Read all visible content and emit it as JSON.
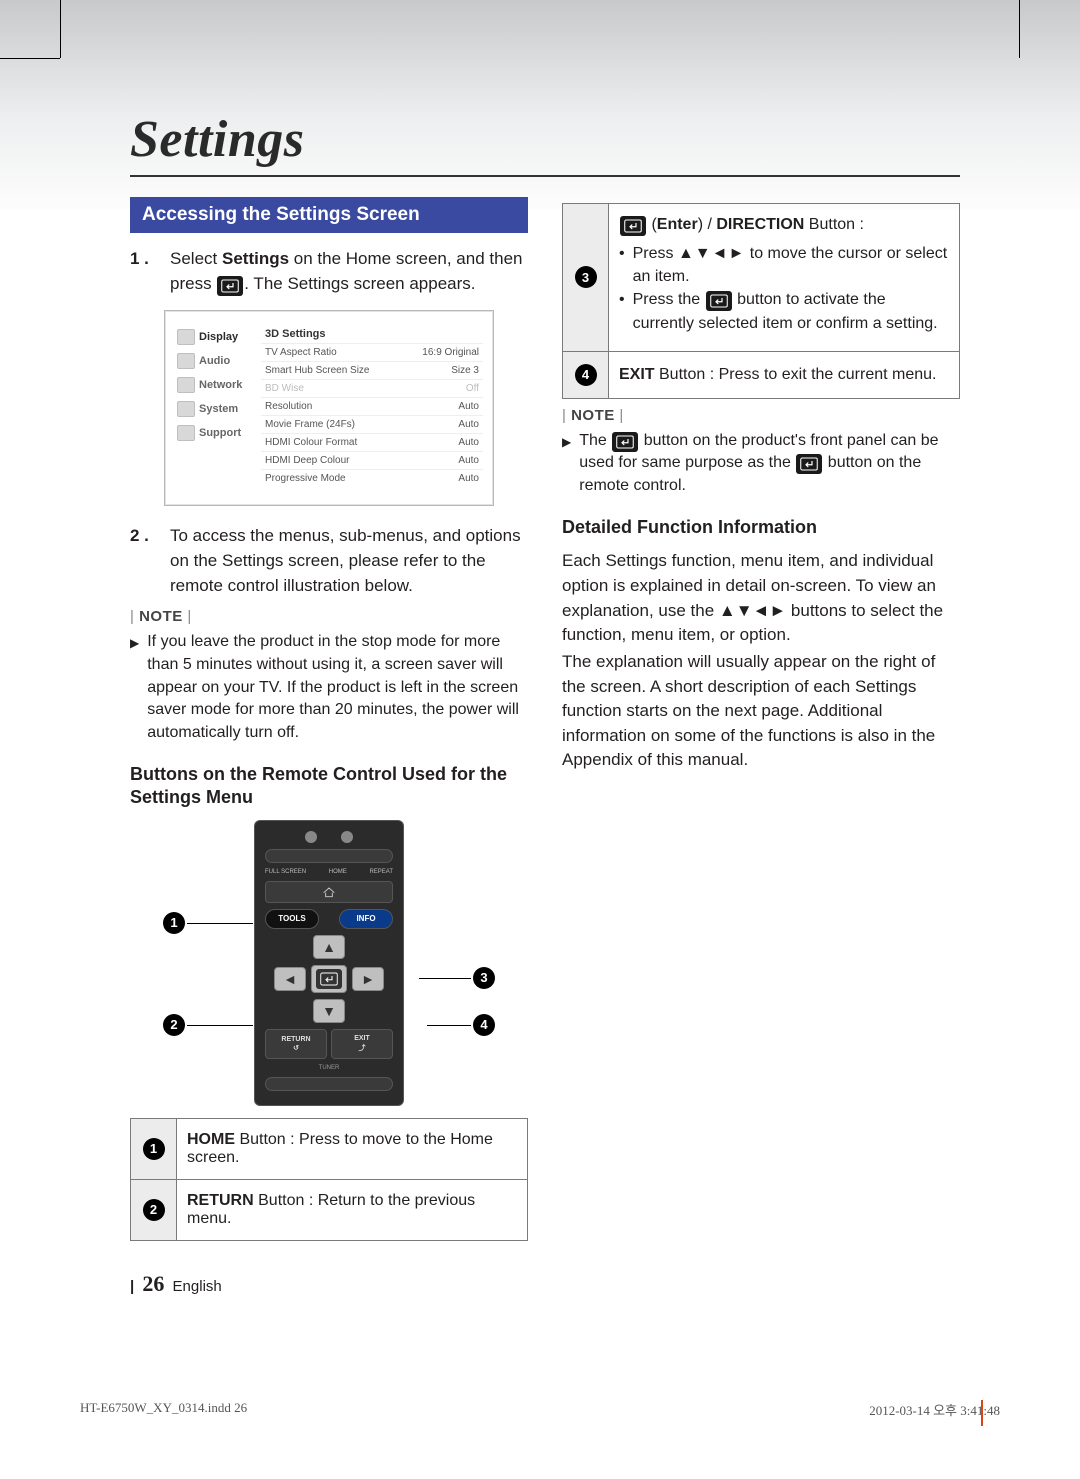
{
  "chapter": "Settings",
  "section_bar": "Accessing the Settings Screen",
  "steps": {
    "s1_pre": "Select ",
    "s1_bold": "Settings",
    "s1_mid": " on the Home screen, and then press ",
    "s1_post": ". The Settings screen appears.",
    "s2": "To access the menus, sub-menus, and options on the Settings screen, please refer to the remote control illustration below."
  },
  "settings_shot": {
    "side": [
      "Display",
      "Audio",
      "Network",
      "System",
      "Support"
    ],
    "rows": [
      {
        "l": "3D Settings",
        "r": ""
      },
      {
        "l": "TV Aspect Ratio",
        "r": "16:9 Original"
      },
      {
        "l": "Smart Hub Screen Size",
        "r": "Size 3"
      },
      {
        "l": "BD Wise",
        "r": "Off",
        "dim": true
      },
      {
        "l": "Resolution",
        "r": "Auto"
      },
      {
        "l": "Movie Frame (24Fs)",
        "r": "Auto"
      },
      {
        "l": "HDMI Colour Format",
        "r": "Auto"
      },
      {
        "l": "HDMI Deep Colour",
        "r": "Auto"
      },
      {
        "l": "Progressive Mode",
        "r": "Auto"
      }
    ]
  },
  "note_label": "NOTE",
  "note1": "If you leave the product in the stop mode for more than 5 minutes without using it, a screen saver will appear on your TV. If the product is left in the screen saver mode for more than 20 minutes, the power will automatically turn off.",
  "sub_head_left": "Buttons on the Remote Control Used for the Settings Menu",
  "remote_labels": {
    "full": "FULL SCREEN",
    "home": "HOME",
    "repeat": "REPEAT",
    "tools": "TOOLS",
    "info": "INFO",
    "return": "RETURN",
    "exit": "EXIT",
    "tuner": "TUNER"
  },
  "btable": {
    "r1_b": "HOME",
    "r1_t": " Button : Press to move to the Home screen.",
    "r2_b": "RETURN",
    "r2_t": " Button : Return to the previous menu.",
    "r3_a": " (",
    "r3_b": "Enter",
    "r3_c": ") / ",
    "r3_d": "DIRECTION",
    "r3_e": " Button :",
    "r3_li1_a": "Press ",
    "r3_li1_b": " to move the cursor or select an item.",
    "r3_li2_a": "Press the ",
    "r3_li2_b": " button to activate the currently selected item or confirm a setting.",
    "r4_b": "EXIT",
    "r4_t": " Button : Press to exit the current menu."
  },
  "note2_a": "The ",
  "note2_b": " button on the product's front panel can be used for same purpose as the ",
  "note2_c": " button on the remote control.",
  "sub_head_right": "Detailed Function Information",
  "para_r1": "Each Settings function, menu item, and individual option is explained in detail on-screen. To view an explanation, use the ▲▼◄► buttons to select the function, menu item, or option.",
  "para_r2": "The explanation will usually appear on the right of the screen. A short description of each Settings function starts on the next page. Additional information on some of the functions is also in the Appendix of this manual.",
  "footer": {
    "page": "26",
    "lang": "English"
  },
  "print": {
    "left": "HT-E6750W_XY_0314.indd   26",
    "right": "2012-03-14   오후 3:41:48"
  }
}
